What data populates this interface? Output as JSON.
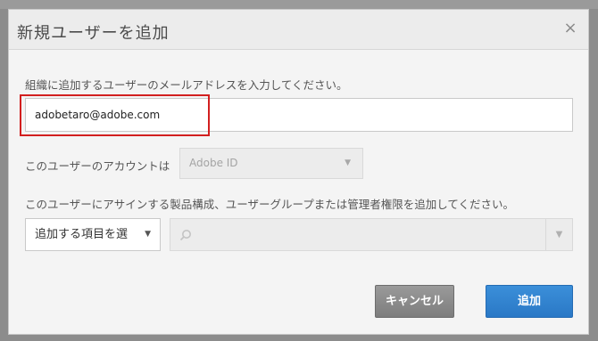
{
  "dialog": {
    "title": "新規ユーザーを追加",
    "close_glyph": "×"
  },
  "email": {
    "label": "組織に追加するユーザーのメールアドレスを入力してください。",
    "value": "adobetaro@adobe.com"
  },
  "account": {
    "label": "このユーザーのアカウントは",
    "selected": "Adobe ID"
  },
  "assign": {
    "label": "このユーザーにアサインする製品構成、ユーザーグループまたは管理者権限を追加してください。",
    "add_item_selected": "追加する項目を選",
    "search_value": ""
  },
  "buttons": {
    "cancel": "キャンセル",
    "add": "追加"
  },
  "colors": {
    "highlight": "#d21f1f",
    "primary": "#2a78c6"
  },
  "icons": [
    "close-icon",
    "chevron-down-icon",
    "search-icon"
  ]
}
